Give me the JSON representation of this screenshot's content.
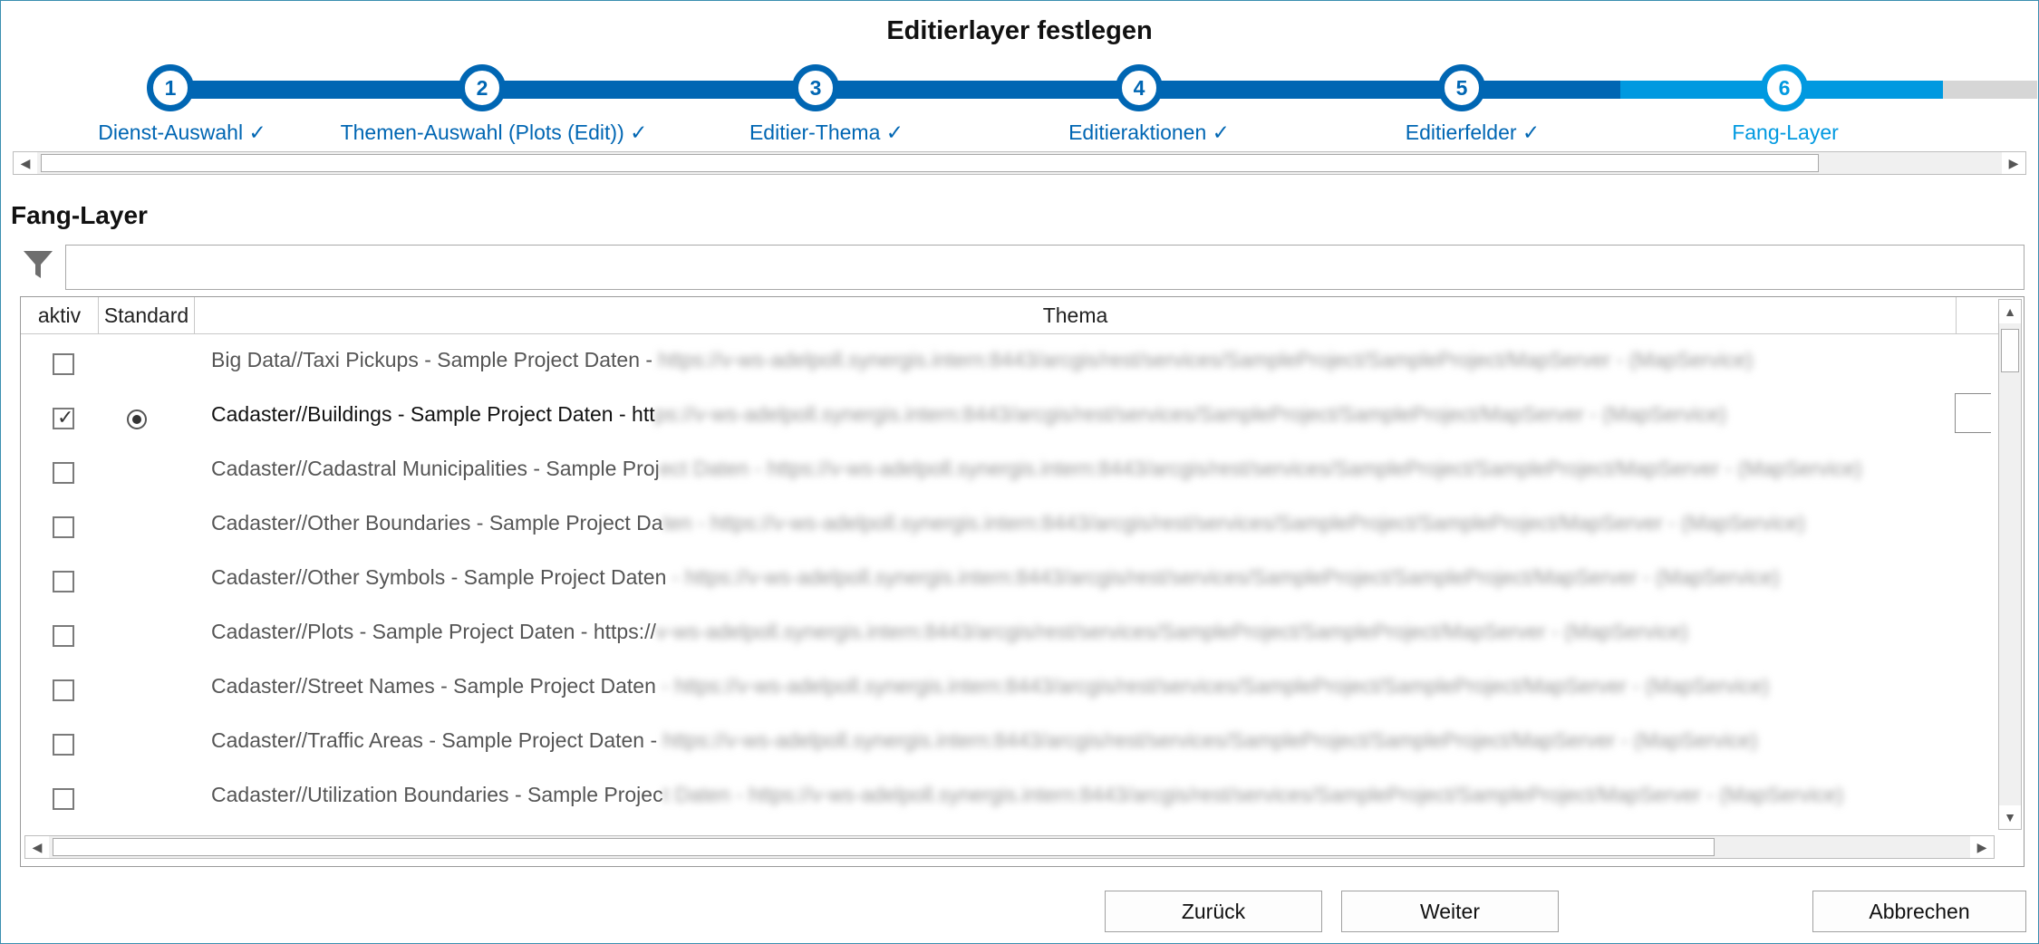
{
  "window": {
    "title": "Editierlayer festlegen"
  },
  "wizard": {
    "steps": [
      {
        "number": "1",
        "label": "Dienst-Auswahl ✓"
      },
      {
        "number": "2",
        "label": "Themen-Auswahl (Plots (Edit)) ✓"
      },
      {
        "number": "3",
        "label": "Editier-Thema ✓"
      },
      {
        "number": "4",
        "label": "Editieraktionen ✓"
      },
      {
        "number": "5",
        "label": "Editierfelder ✓"
      },
      {
        "number": "6",
        "label": "Fang-Layer"
      }
    ],
    "current_step": 6,
    "colors": {
      "done": "#0066b3",
      "current": "#0099e0",
      "pending": "#d6d6d6"
    }
  },
  "section": {
    "title": "Fang-Layer"
  },
  "filter": {
    "icon": "filter-icon",
    "value": ""
  },
  "table": {
    "columns": [
      "aktiv",
      "Standard",
      "Thema"
    ],
    "rows": [
      {
        "aktiv": false,
        "standard": false,
        "name": "Big Data//Taxi Pickups - Sample Project Daten - ",
        "url": "https://v-ws-adelpoll.synergis.intern:8443/arcgis/rest/services/SampleProject/SampleProject/MapServer - (MapService)"
      },
      {
        "aktiv": true,
        "standard": true,
        "name": "Cadaster//Buildings - Sample Project Daten - htt",
        "url": "ps://v-ws-adelpoll.synergis.intern:8443/arcgis/rest/services/SampleProject/SampleProject/MapServer - (MapService)"
      },
      {
        "aktiv": false,
        "standard": false,
        "name": "Cadaster//Cadastral Municipalities - Sample Proj",
        "url": "ect Daten - https://v-ws-adelpoll.synergis.intern:8443/arcgis/rest/services/SampleProject/SampleProject/MapServer - (MapService)"
      },
      {
        "aktiv": false,
        "standard": false,
        "name": "Cadaster//Other Boundaries - Sample Project Da",
        "url": "ten - https://v-ws-adelpoll.synergis.intern:8443/arcgis/rest/services/SampleProject/SampleProject/MapServer - (MapService)"
      },
      {
        "aktiv": false,
        "standard": false,
        "name": "Cadaster//Other Symbols - Sample Project Daten",
        "url": " - https://v-ws-adelpoll.synergis.intern:8443/arcgis/rest/services/SampleProject/SampleProject/MapServer - (MapService)"
      },
      {
        "aktiv": false,
        "standard": false,
        "name": "Cadaster//Plots - Sample Project Daten - https://",
        "url": "v-ws-adelpoll.synergis.intern:8443/arcgis/rest/services/SampleProject/SampleProject/MapServer - (MapService)"
      },
      {
        "aktiv": false,
        "standard": false,
        "name": "Cadaster//Street Names - Sample Project Daten",
        "url": " - https://v-ws-adelpoll.synergis.intern:8443/arcgis/rest/services/SampleProject/SampleProject/MapServer - (MapService)"
      },
      {
        "aktiv": false,
        "standard": false,
        "name": "Cadaster//Traffic Areas - Sample Project Daten - ",
        "url": "https://v-ws-adelpoll.synergis.intern:8443/arcgis/rest/services/SampleProject/SampleProject/MapServer - (MapService)"
      },
      {
        "aktiv": false,
        "standard": false,
        "name": "Cadaster//Utilization Boundaries - Sample Projec",
        "url": "t Daten - https://v-ws-adelpoll.synergis.intern:8443/arcgis/rest/services/SampleProject/SampleProject/MapServer - (MapService)"
      }
    ]
  },
  "buttons": {
    "back": "Zurück",
    "next": "Weiter",
    "cancel": "Abbrechen"
  }
}
